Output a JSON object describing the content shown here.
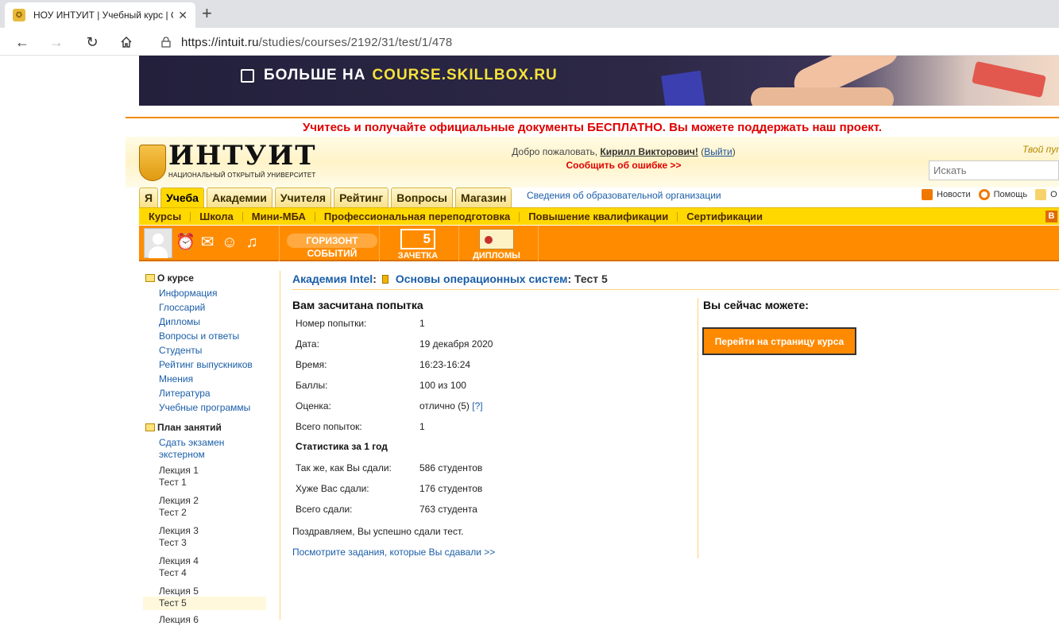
{
  "browser": {
    "tab_title": "НОУ ИНТУИТ | Учебный курс | О",
    "url_host": "https://intuit.ru",
    "url_path": "/studies/courses/2192/31/test/1/478",
    "new_tab": "+",
    "close_tab": "✕"
  },
  "banner": {
    "text": "БОЛЬШЕ НА",
    "highlight": "COURSE.SKILLBOX.RU"
  },
  "promo": "Учитесь и получайте официальные документы БЕСПЛАТНО. Вы можете поддержать наш проект.",
  "header": {
    "logo_name": "ИНТУИТ",
    "logo_sub": "НАЦИОНАЛЬНЫЙ ОТКРЫТЫЙ УНИВЕРСИТЕТ",
    "welcome_prefix": "Добро пожаловать,",
    "user_name": "Кирилл Викторович!",
    "logout_open": "(",
    "logout": "Выйти",
    "logout_close": ")",
    "report_error": "Сообщить об ошибке >>",
    "tagline": "Твой пут",
    "search_placeholder": "Искать"
  },
  "main_tabs": [
    "Я",
    "Учеба",
    "Академии",
    "Учителя",
    "Рейтинг",
    "Вопросы",
    "Магазин"
  ],
  "org_info_link": "Сведения об образовательной организации",
  "top_links": {
    "news": "Новости",
    "help": "Помощь",
    "more": "О"
  },
  "sub_nav": [
    "Курсы",
    "Школа",
    "Мини-МБА",
    "Профессиональная переподготовка",
    "Повышение квалификации",
    "Сертификации"
  ],
  "sub_nav_vk": "В",
  "orange_bar": {
    "horizon_top": "ГОРИЗОНТ",
    "horizon_bottom": "СОБЫТИЙ",
    "zachetka_num": "5",
    "zachetka": "ЗАЧЕТКА",
    "diplomas": "ДИПЛОМЫ"
  },
  "sidebar": {
    "about_title": "О курсе",
    "about_links": [
      "Информация",
      "Глоссарий",
      "Дипломы",
      "Вопросы и ответы",
      "Студенты",
      "Рейтинг выпускников",
      "Мнения",
      "Литература",
      "Учебные программы"
    ],
    "plan_title": "План занятий",
    "exam_line1": "Сдать экзамен",
    "exam_line2": "экстерном",
    "lessons": [
      {
        "lecture": "Лекция 1",
        "test": "Тест 1"
      },
      {
        "lecture": "Лекция 2",
        "test": "Тест 2"
      },
      {
        "lecture": "Лекция 3",
        "test": "Тест 3"
      },
      {
        "lecture": "Лекция 4",
        "test": "Тест 4"
      },
      {
        "lecture": "Лекция 5",
        "test": "Тест 5"
      }
    ],
    "next_cut": "Лекция 6"
  },
  "breadcrumb": {
    "academy": "Академия Intel",
    "sep1": ":",
    "course": "Основы операционных систем",
    "sep2": ":",
    "test": "Тест 5"
  },
  "result": {
    "heading": "Вам засчитана попытка",
    "rows": [
      {
        "label": "Номер попытки:",
        "value": "1"
      },
      {
        "label": "Дата:",
        "value": "19 декабря 2020"
      },
      {
        "label": "Время:",
        "value": "16:23-16:24"
      },
      {
        "label": "Баллы:",
        "value": "100 из 100"
      },
      {
        "label": "Оценка:",
        "value": "отлично (5)"
      },
      {
        "label": "Всего попыток:",
        "value": "1"
      }
    ],
    "grade_help": "[?]",
    "stats_heading": "Статистика за 1 год",
    "stats": [
      {
        "label": "Так же, как Вы сдали:",
        "value": "586 студентов"
      },
      {
        "label": "Хуже Вас сдали:",
        "value": "176 студентов"
      },
      {
        "label": "Всего сдали:",
        "value": "763 студента"
      }
    ],
    "congrats": "Поздравляем, Вы успешно сдали тест.",
    "tasks_link": "Посмотрите задания, которые Вы сдавали >>"
  },
  "actions": {
    "heading": "Вы сейчас можете:",
    "go_course": "Перейти на страницу курса"
  }
}
